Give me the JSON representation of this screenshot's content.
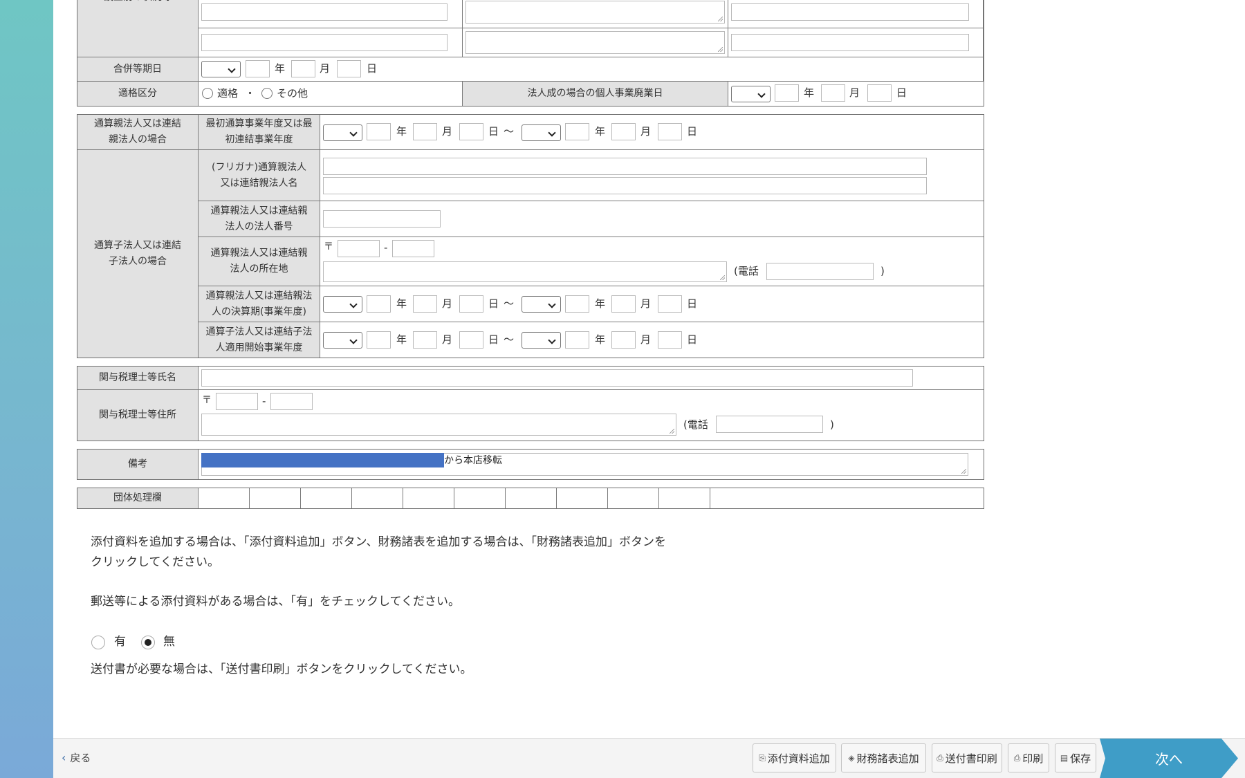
{
  "form": {
    "setsuritsu_label": "設立前の状況等",
    "gappei_date_label": "合併等期日",
    "tekikaku_label": "適格区分",
    "tekikaku_option_yes": "適格",
    "tekikaku_sep": "・",
    "tekikaku_option_other": "その他",
    "kojin_haigyo_label": "法人成の場合の個人事業廃業日",
    "tsusan_oya_label": "通算親法人又は連結親法人の場合",
    "saisho_nendo_label": "最初通算事業年度又は最初連結事業年度",
    "tsusan_ko_label": "通算子法人又は連結子法人の場合",
    "oya_name_label": "(フリガナ)通算親法人又は連結親法人名",
    "oya_number_label": "通算親法人又は連結親法人の法人番号",
    "oya_address_label": "通算親法人又は連結親法人の所在地",
    "oya_kessan_label": "通算親法人又は連結親法人の決算期(事業年度)",
    "ko_tekiyo_label": "通算子法人又は連結子法人適用開始事業年度",
    "zeirishi_name_label": "関与税理士等氏名",
    "zeirishi_address_label": "関与税理士等住所",
    "biko_label": "備考",
    "biko_value": "から本店移転",
    "dantai_label": "団体処理欄",
    "year_unit": "年",
    "month_unit": "月",
    "day_unit": "日",
    "range_sep": "〜",
    "postal_mark": "〒",
    "postal_dash": "-",
    "phone_open": "(電話",
    "phone_close": ")"
  },
  "instructions": {
    "line1": "添付資料を追加する場合は、「添付資料追加」ボタン、財務諸表を追加する場合は、「財務諸表追加」ボタンを",
    "line2": "クリックしてください。",
    "line3": "郵送等による添付資料がある場合は、「有」をチェックしてください。",
    "radio_yes": "有",
    "radio_no": "無",
    "selected": "無",
    "line4": "送付書が必要な場合は、「送付書印刷」ボタンをクリックしてください。"
  },
  "footer": {
    "back": "戻る",
    "attach": "添付資料追加",
    "financial": "財務諸表追加",
    "cover_print": "送付書印刷",
    "print": "印刷",
    "save": "保存",
    "next": "次へ"
  },
  "colors": {
    "label_bg": "#e2e2e2",
    "accent": "#3f9dc7",
    "redaction": "#4472c4",
    "side_strip": "#72bccb"
  }
}
